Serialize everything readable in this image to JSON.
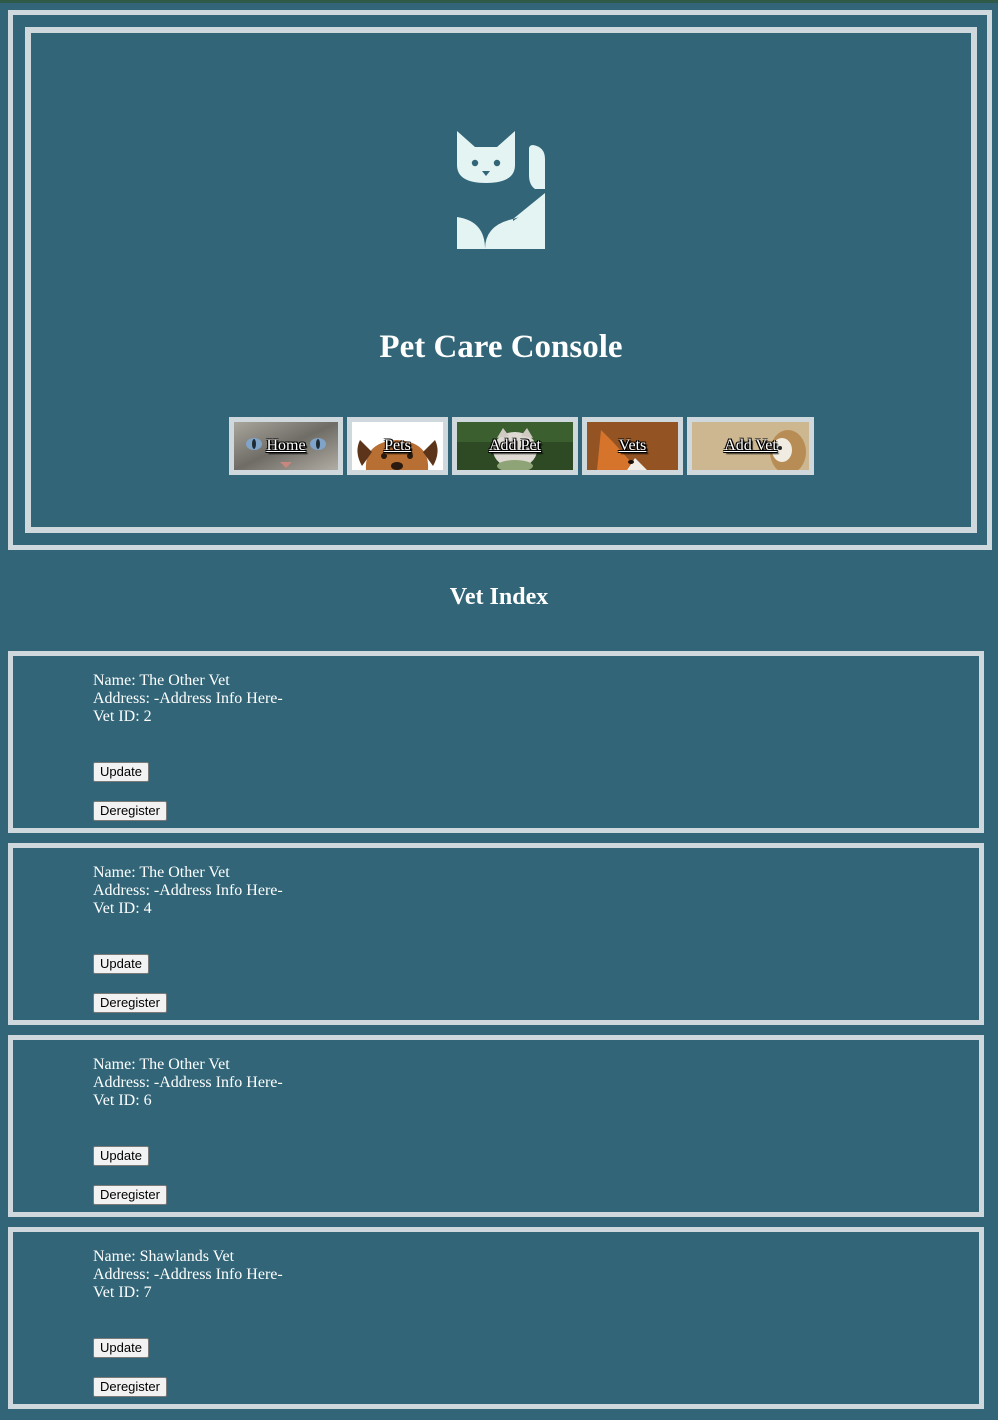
{
  "header": {
    "title": "Pet Care Console",
    "nav": [
      {
        "label": "Home",
        "icon": "cat-photo"
      },
      {
        "label": "Pets",
        "icon": "dog-photo"
      },
      {
        "label": "Add Pet",
        "icon": "kitten-photo"
      },
      {
        "label": "Vets",
        "icon": "fox-photo"
      },
      {
        "label": "Add Vet",
        "icon": "owl-photo"
      }
    ]
  },
  "main": {
    "section_title": "Vet Index",
    "vets": [
      {
        "name": "Name: The Other Vet",
        "address": "Address: -Address Info Here-",
        "id": "Vet ID: 2",
        "update_label": "Update",
        "deregister_label": "Deregister"
      },
      {
        "name": "Name: The Other Vet",
        "address": "Address: -Address Info Here-",
        "id": "Vet ID: 4",
        "update_label": "Update",
        "deregister_label": "Deregister"
      },
      {
        "name": "Name: The Other Vet",
        "address": "Address: -Address Info Here-",
        "id": "Vet ID: 6",
        "update_label": "Update",
        "deregister_label": "Deregister"
      },
      {
        "name": "Name: Shawlands Vet",
        "address": "Address: -Address Info Here-",
        "id": "Vet ID: 7",
        "update_label": "Update",
        "deregister_label": "Deregister"
      }
    ]
  },
  "colors": {
    "background": "#316577",
    "border": "#cfd8dc",
    "logo": "#e3f4f3"
  }
}
